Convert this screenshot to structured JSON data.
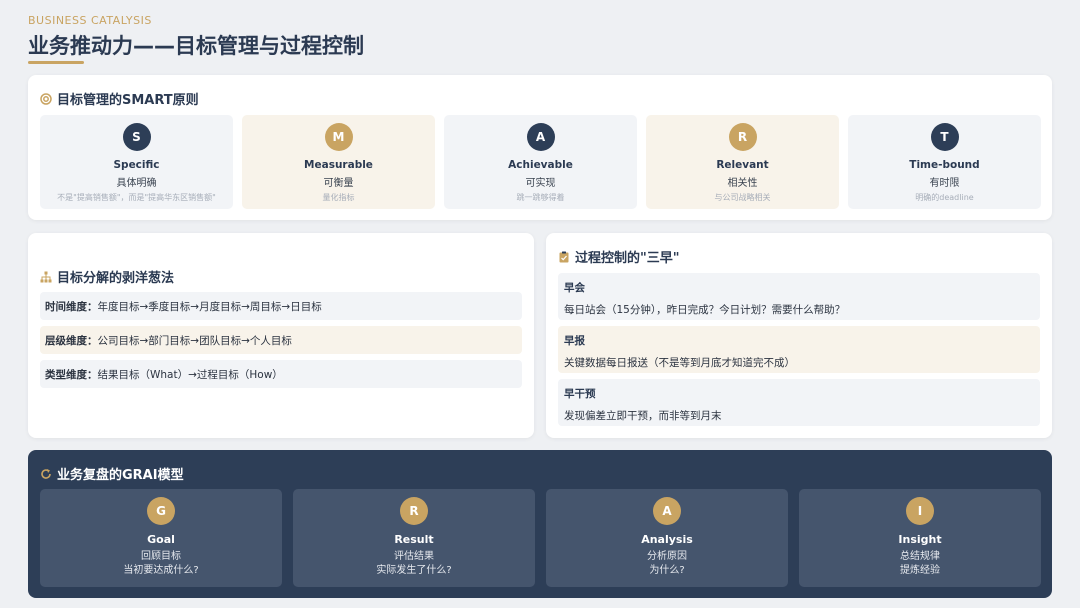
{
  "header": {
    "eyebrow": "BUSINESS CATALYSIS",
    "title": "业务推动力——目标管理与过程控制"
  },
  "smart": {
    "heading": "目标管理的SMART原则",
    "icon": "target-icon",
    "items": [
      {
        "letter": "S",
        "en": "Specific",
        "cn": "具体明确",
        "note": "不是\"提高销售额\"，而是\"提高华东区销售额\"",
        "style": "navy"
      },
      {
        "letter": "M",
        "en": "Measurable",
        "cn": "可衡量",
        "note": "量化指标",
        "style": "gold"
      },
      {
        "letter": "A",
        "en": "Achievable",
        "cn": "可实现",
        "note": "跳一跳够得着",
        "style": "navy"
      },
      {
        "letter": "R",
        "en": "Relevant",
        "cn": "相关性",
        "note": "与公司战略相关",
        "style": "gold"
      },
      {
        "letter": "T",
        "en": "Time-bound",
        "cn": "有时限",
        "note": "明确的deadline",
        "style": "navy"
      }
    ]
  },
  "split": {
    "heading": "目标分解的剥洋葱法",
    "icon": "hierarchy-icon",
    "rows": [
      {
        "label": "时间维度：",
        "text": "年度目标→季度目标→月度目标→周目标→日目标"
      },
      {
        "label": "层级维度：",
        "text": "公司目标→部门目标→团队目标→个人目标"
      },
      {
        "label": "类型维度：",
        "text": "结果目标（What）→过程目标（How）"
      }
    ]
  },
  "three": {
    "heading": "过程控制的\"三早\"",
    "icon": "clipboard-icon",
    "items": [
      {
        "title": "早会",
        "desc": "每日站会（15分钟），昨日完成？今日计划？需要什么帮助？"
      },
      {
        "title": "早报",
        "desc": "关键数据每日报送（不是等到月底才知道完不成）"
      },
      {
        "title": "早干预",
        "desc": "发现偏差立即干预，而非等到月末"
      }
    ]
  },
  "grai": {
    "heading": "业务复盘的GRAI模型",
    "icon": "refresh-icon",
    "items": [
      {
        "letter": "G",
        "en": "Goal",
        "line1": "回顾目标",
        "line2": "当初要达成什么?"
      },
      {
        "letter": "R",
        "en": "Result",
        "line1": "评估结果",
        "line2": "实际发生了什么?"
      },
      {
        "letter": "A",
        "en": "Analysis",
        "line1": "分析原因",
        "line2": "为什么?"
      },
      {
        "letter": "I",
        "en": "Insight",
        "line1": "总结规律",
        "line2": "提炼经验"
      }
    ]
  },
  "colors": {
    "navy": "#2d3e57",
    "gold": "#c9a462",
    "background": "#eef0f3"
  }
}
